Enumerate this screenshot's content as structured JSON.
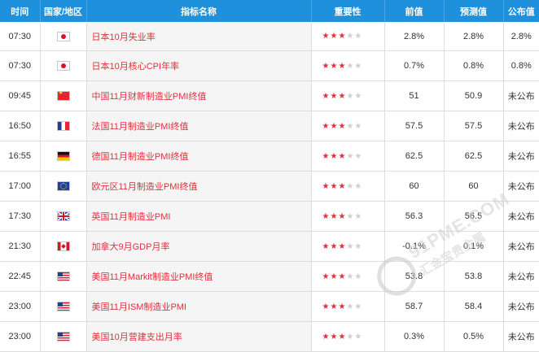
{
  "header": {
    "time": "时间",
    "country": "国家/地区",
    "indicator": "指标名称",
    "importance": "重要性",
    "previous": "前值",
    "forecast": "预测值",
    "published": "公布值"
  },
  "rows": [
    {
      "time": "07:30",
      "flag": "jp",
      "flag_icon": "japan-flag-icon",
      "name": "日本10月失业率",
      "stars": 3,
      "previous": "2.8%",
      "forecast": "2.8%",
      "published": "2.8%"
    },
    {
      "time": "07:30",
      "flag": "jp",
      "flag_icon": "japan-flag-icon",
      "name": "日本10月核心CPI年率",
      "stars": 3,
      "previous": "0.7%",
      "forecast": "0.8%",
      "published": "0.8%"
    },
    {
      "time": "09:45",
      "flag": "cn",
      "flag_icon": "china-flag-icon",
      "name": "中国11月财新制造业PMI终值",
      "stars": 3,
      "previous": "51",
      "forecast": "50.9",
      "published": "未公布"
    },
    {
      "time": "16:50",
      "flag": "fr",
      "flag_icon": "france-flag-icon",
      "name": "法国11月制造业PMI终值",
      "stars": 3,
      "previous": "57.5",
      "forecast": "57.5",
      "published": "未公布"
    },
    {
      "time": "16:55",
      "flag": "de",
      "flag_icon": "germany-flag-icon",
      "name": "德国11月制造业PMI终值",
      "stars": 3,
      "previous": "62.5",
      "forecast": "62.5",
      "published": "未公布"
    },
    {
      "time": "17:00",
      "flag": "eu",
      "flag_icon": "eu-flag-icon",
      "name": "欧元区11月制造业PMI终值",
      "stars": 3,
      "previous": "60",
      "forecast": "60",
      "published": "未公布"
    },
    {
      "time": "17:30",
      "flag": "gb",
      "flag_icon": "uk-flag-icon",
      "name": "英国11月制造业PMI",
      "stars": 3,
      "previous": "56.3",
      "forecast": "56.5",
      "published": "未公布"
    },
    {
      "time": "21:30",
      "flag": "ca",
      "flag_icon": "canada-flag-icon",
      "name": "加拿大9月GDP月率",
      "stars": 3,
      "previous": "-0.1%",
      "forecast": "0.1%",
      "published": "未公布"
    },
    {
      "time": "22:45",
      "flag": "us",
      "flag_icon": "usa-flag-icon",
      "name": "美国11月Markit制造业PMI终值",
      "stars": 3,
      "previous": "53.8",
      "forecast": "53.8",
      "published": "未公布"
    },
    {
      "time": "23:00",
      "flag": "us",
      "flag_icon": "usa-flag-icon",
      "name": "美国11月ISM制造业PMI",
      "stars": 3,
      "previous": "58.7",
      "forecast": "58.4",
      "published": "未公布"
    },
    {
      "time": "23:00",
      "flag": "us",
      "flag_icon": "usa-flag-icon",
      "name": "美国10月营建支出月率",
      "stars": 3,
      "previous": "0.3%",
      "forecast": "0.5%",
      "published": "未公布"
    }
  ],
  "max_stars": 5,
  "watermark": {
    "main": "91PME.COM",
    "sub": "汇金宝贵金属"
  },
  "colors": {
    "header_bg": "#1e90dc",
    "name_text": "#e0303c",
    "star_on": "#e0303c",
    "star_off": "#cfcfcf"
  }
}
